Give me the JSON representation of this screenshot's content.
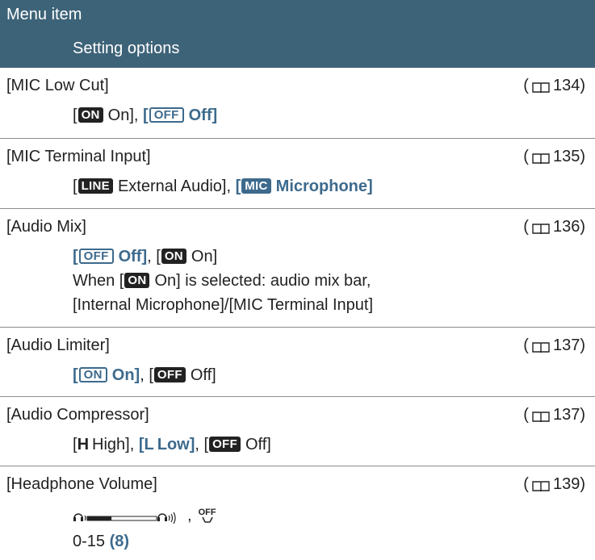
{
  "header": {
    "title": "Menu item",
    "subtitle": "Setting options"
  },
  "rows": [
    {
      "name": "[MIC Low Cut]",
      "ref": "134",
      "options": [
        {
          "pre": "[",
          "icon": "ON",
          "label": "On]",
          "sep": ", "
        },
        {
          "pre": "[",
          "icon": "OFF",
          "label": "Off]",
          "highlight": true
        }
      ]
    },
    {
      "name": "[MIC Terminal Input]",
      "ref": "135",
      "options": [
        {
          "pre": "[",
          "icon": "LINE",
          "label": "External Audio]",
          "sep": ", "
        },
        {
          "pre": "[",
          "icon": "MIC",
          "label": "Microphone]",
          "highlight": true
        }
      ]
    },
    {
      "name": "[Audio Mix]",
      "ref": "136",
      "options": [
        {
          "pre": "[",
          "icon": "OFF",
          "label": "Off]",
          "highlight": true,
          "sep": ", "
        },
        {
          "pre": "[",
          "icon": "ON",
          "label": "On]"
        }
      ],
      "note": {
        "pre": "When [",
        "icon": "ON",
        "post": "On] is selected: audio mix bar,",
        "line2": "[Internal Microphone]/[MIC Terminal Input]"
      }
    },
    {
      "name": "[Audio Limiter]",
      "ref": "137",
      "options": [
        {
          "pre": "[",
          "icon": "ON",
          "label": "On]",
          "highlight": true,
          "sep": ", "
        },
        {
          "pre": "[",
          "icon": "OFF",
          "label": "Off]"
        }
      ]
    },
    {
      "name": "[Audio Compressor]",
      "ref": "137",
      "options": [
        {
          "pre": "[",
          "letter": "H",
          "label": "High]",
          "sep": ", "
        },
        {
          "pre": "[",
          "letter": "L",
          "label": "Low]",
          "highlight": true,
          "sep": ", "
        },
        {
          "pre": "[",
          "icon": "OFF",
          "label": "Off]"
        }
      ]
    },
    {
      "name": "[Headphone Volume]",
      "ref": "139",
      "range": "0-15",
      "default": "(8)",
      "volume_fill": 0.35,
      "off_icon_label": "OFF"
    }
  ],
  "ref_prefix": "(",
  "ref_suffix": ")",
  "colors": {
    "header_bg": "#3d6378",
    "highlight": "#3d6a8d",
    "badge": "#222222"
  }
}
